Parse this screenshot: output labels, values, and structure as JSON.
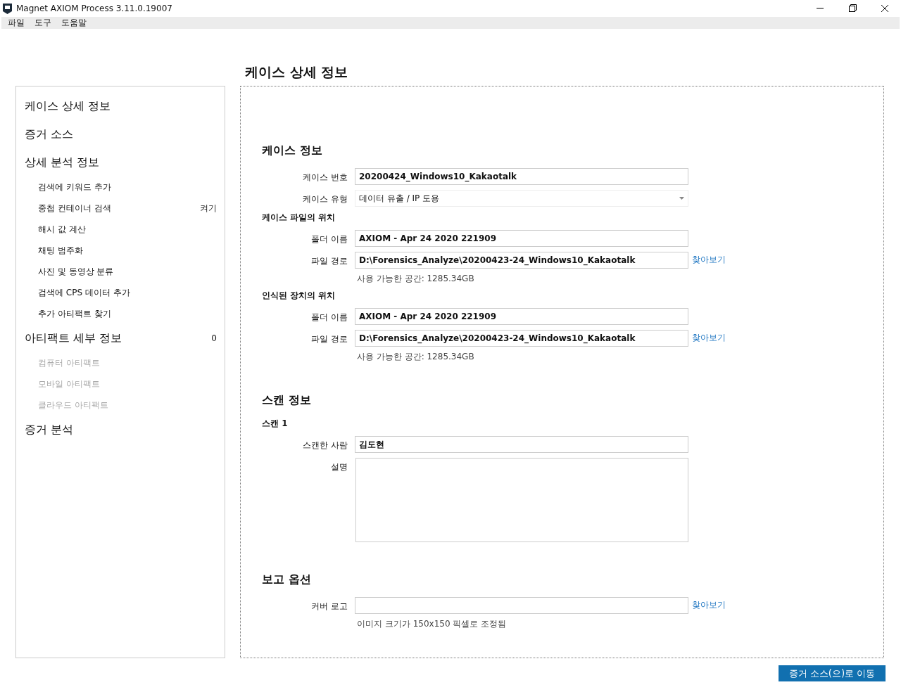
{
  "window": {
    "title": "Magnet AXIOM Process 3.11.0.19007"
  },
  "menu": [
    "파일",
    "도구",
    "도움말"
  ],
  "page_title": "케이스 상세 정보",
  "sidebar": {
    "items": [
      {
        "kind": "section",
        "label": "케이스 상세 정보",
        "disabled": false
      },
      {
        "kind": "section",
        "label": "증거 소스",
        "disabled": false
      },
      {
        "kind": "section",
        "label": "상세 분석 정보",
        "disabled": false
      },
      {
        "kind": "sub",
        "label": "검색에 키워드 추가",
        "disabled": false
      },
      {
        "kind": "sub",
        "label": "중첩 컨테이너 검색",
        "value": "켜기",
        "disabled": false
      },
      {
        "kind": "sub",
        "label": "해시 값 계산",
        "disabled": false
      },
      {
        "kind": "sub",
        "label": "채팅 범주화",
        "disabled": false
      },
      {
        "kind": "sub",
        "label": "사진 및 동영상 분류",
        "disabled": false
      },
      {
        "kind": "sub",
        "label": "검색에 CPS 데이터 추가",
        "disabled": false
      },
      {
        "kind": "sub",
        "label": "추가 아티팩트 찾기",
        "disabled": false
      },
      {
        "kind": "section",
        "label": "아티팩트 세부 정보",
        "value": "0",
        "disabled": false
      },
      {
        "kind": "sub",
        "label": "컴퓨터 아티팩트",
        "disabled": true
      },
      {
        "kind": "sub",
        "label": "모바일 아티팩트",
        "disabled": true
      },
      {
        "kind": "sub",
        "label": "클라우드 아티팩트",
        "disabled": true
      },
      {
        "kind": "section",
        "label": "증거 분석",
        "disabled": false
      }
    ]
  },
  "form": [
    {
      "kind": "heading",
      "text": "케이스 정보"
    },
    {
      "kind": "text",
      "label": "케이스 번호",
      "value": "20200424_Windows10_Kakaotalk"
    },
    {
      "kind": "dropdown",
      "label": "케이스 유형",
      "value": "데이터 유출 / IP 도용"
    },
    {
      "kind": "subheading",
      "text": "케이스 파일의 위치"
    },
    {
      "kind": "text",
      "label": "폴더 이름",
      "value": "AXIOM - Apr 24 2020 221909"
    },
    {
      "kind": "text",
      "label": "파일 경로",
      "value": "D:\\Forensics_Analyze\\20200423-24_Windows10_Kakaotalk",
      "link": "찾아보기",
      "note": "사용 가능한 공간: 1285.34GB"
    },
    {
      "kind": "subheading",
      "text": "인식된 장치의 위치"
    },
    {
      "kind": "text",
      "label": "폴더 이름",
      "value": "AXIOM - Apr 24 2020 221909"
    },
    {
      "kind": "text",
      "label": "파일 경로",
      "value": "D:\\Forensics_Analyze\\20200423-24_Windows10_Kakaotalk",
      "link": "찾아보기",
      "note": "사용 가능한 공간: 1285.34GB"
    },
    {
      "kind": "heading",
      "text": "스캔 정보"
    },
    {
      "kind": "subheading",
      "text": "스캔 1"
    },
    {
      "kind": "text",
      "label": "스캔한 사람",
      "value": "김도현"
    },
    {
      "kind": "textarea",
      "label": "설명"
    },
    {
      "kind": "heading",
      "text": "보고 옵션"
    },
    {
      "kind": "text",
      "label": "커버 로고",
      "link": "찾아보기",
      "note": "이미지 크기가 150x150 픽셀로 조정됨"
    }
  ],
  "next_button": "증거 소스(으)로 이동"
}
